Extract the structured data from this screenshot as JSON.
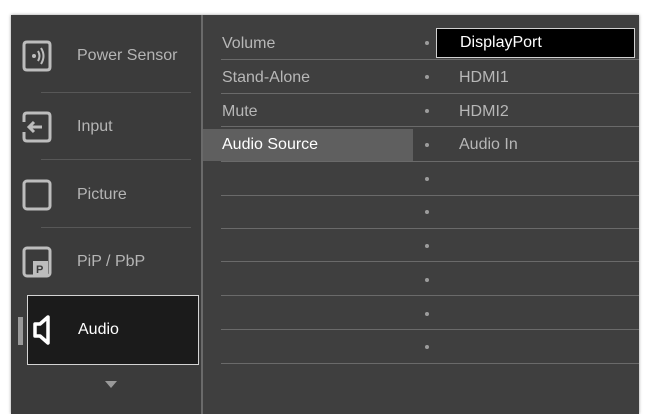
{
  "main_menu": {
    "items": [
      {
        "label": "Power Sensor",
        "icon": "power-sensor-icon"
      },
      {
        "label": "Input",
        "icon": "input-icon"
      },
      {
        "label": "Picture",
        "icon": "picture-icon"
      },
      {
        "label": "PiP / PbP",
        "icon": "pip-pbp-icon"
      },
      {
        "label": "Audio",
        "icon": "audio-speaker-icon",
        "selected": true
      }
    ],
    "more_indicator": "chevron-down-icon"
  },
  "submenu": {
    "items": [
      {
        "label": "Volume"
      },
      {
        "label": "Stand-Alone"
      },
      {
        "label": "Mute"
      },
      {
        "label": "Audio Source",
        "active": true
      }
    ]
  },
  "options": {
    "items": [
      {
        "label": "DisplayPort",
        "selected": true
      },
      {
        "label": "HDMI1"
      },
      {
        "label": "HDMI2"
      },
      {
        "label": "Audio In"
      }
    ]
  },
  "colors": {
    "background": "#3f3f3f",
    "selected_bg": "#000000",
    "highlight_row": "#5f5f5f",
    "text": "#b7b7b7",
    "text_active": "#ffffff"
  }
}
